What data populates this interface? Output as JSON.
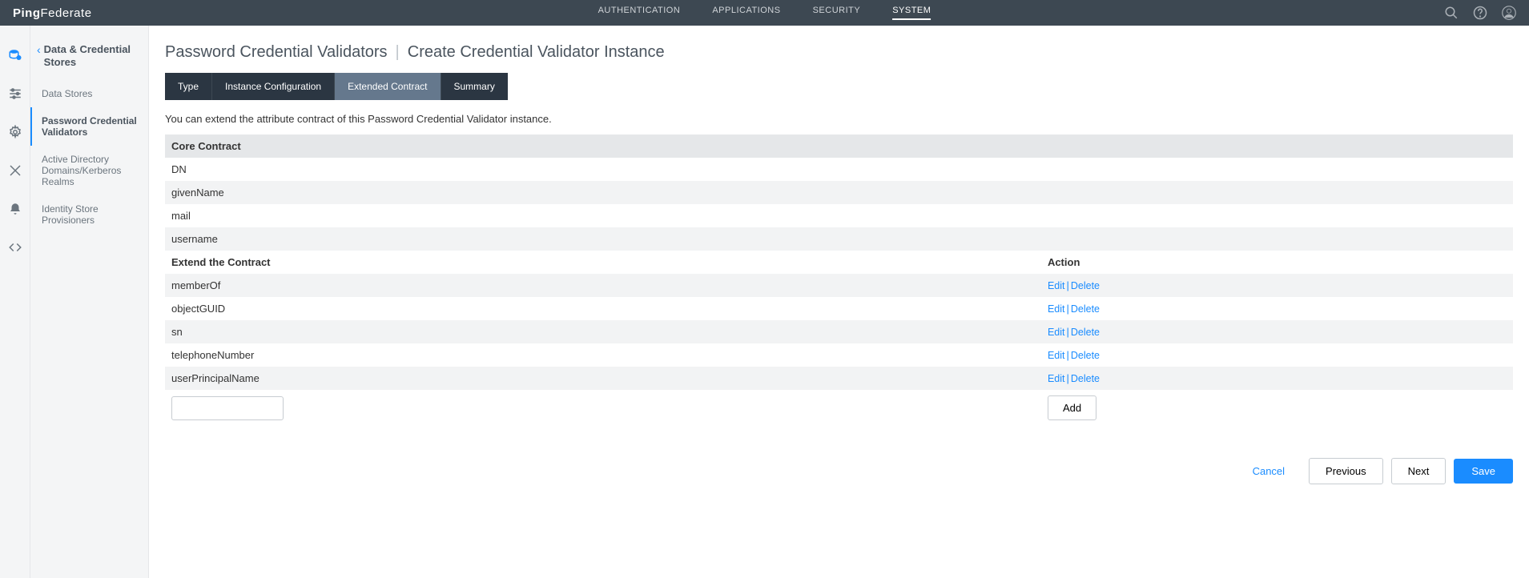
{
  "header": {
    "logo_prefix": "Ping",
    "logo_suffix": "Federate",
    "nav": {
      "auth": "AUTHENTICATION",
      "apps": "APPLICATIONS",
      "security": "SECURITY",
      "system": "SYSTEM"
    }
  },
  "sidebar": {
    "title": "Data & Credential Stores",
    "items": [
      "Data Stores",
      "Password Credential Validators",
      "Active Directory Domains/Kerberos Realms",
      "Identity Store Provisioners"
    ]
  },
  "breadcrumb": {
    "a": "Password Credential Validators",
    "b": "Create Credential Validator Instance"
  },
  "tabs": {
    "type": "Type",
    "instance": "Instance Configuration",
    "extended": "Extended Contract",
    "summary": "Summary"
  },
  "description": "You can extend the attribute contract of this Password Credential Validator instance.",
  "table": {
    "core_header": "Core Contract",
    "core_rows": [
      "DN",
      "givenName",
      "mail",
      "username"
    ],
    "extend_header": "Extend the Contract",
    "action_header": "Action",
    "extend_rows": [
      "memberOf",
      "objectGUID",
      "sn",
      "telephoneNumber",
      "userPrincipalName"
    ],
    "edit": "Edit",
    "delete": "Delete",
    "add": "Add"
  },
  "buttons": {
    "cancel": "Cancel",
    "previous": "Previous",
    "next": "Next",
    "save": "Save"
  }
}
